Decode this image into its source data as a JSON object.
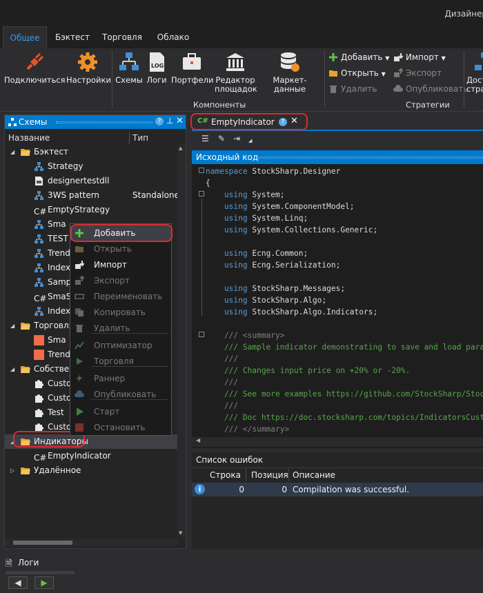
{
  "window": {
    "title": "Дизайнер"
  },
  "ribbon_tabs": [
    "Общее",
    "Бэктест",
    "Торговля",
    "Облако"
  ],
  "ribbon": {
    "connect": "Подключиться",
    "settings": "Настройки",
    "schemes": "Схемы",
    "logs": "Логи",
    "portfolios": "Портфели",
    "board_editor": "Редактор площадок",
    "market_data": "Маркет-данные",
    "components_group": "Компоненты",
    "add": "Добавить",
    "import": "Импорт",
    "open": "Открыть",
    "export": "Экспорт",
    "delete": "Удалить",
    "publish": "Опубликовать",
    "strategies_group": "Стратегии",
    "available": "Дост",
    "available2": "стра"
  },
  "schemes_panel": {
    "title": "Схемы",
    "col_name": "Название",
    "col_type": "Тип",
    "rows": [
      {
        "label": "Бэктест",
        "type": ""
      },
      {
        "label": "Strategy",
        "type": ""
      },
      {
        "label": "designertestdll",
        "type": ""
      },
      {
        "label": "3WS pattern",
        "type": "Standalone"
      },
      {
        "label": "EmptyStrategy",
        "type": ""
      },
      {
        "label": "Sma",
        "type": ""
      },
      {
        "label": "TEST",
        "type": ""
      },
      {
        "label": "Trend",
        "type": ""
      },
      {
        "label": "Index",
        "type": ""
      },
      {
        "label": "Sampl",
        "type": ""
      },
      {
        "label": "SmaSt",
        "type": ""
      },
      {
        "label": "Index",
        "type": ""
      },
      {
        "label": "Торговля",
        "type": ""
      },
      {
        "label": "Sma",
        "type": ""
      },
      {
        "label": "Trend",
        "type": ""
      },
      {
        "label": "Собствен",
        "type": ""
      },
      {
        "label": "Custor",
        "type": ""
      },
      {
        "label": "Custor",
        "type": ""
      },
      {
        "label": "Test",
        "type": ""
      },
      {
        "label": "Custor",
        "type": ""
      },
      {
        "label": "Индикаторы",
        "type": ""
      },
      {
        "label": "EmptyIndicator",
        "type": ""
      },
      {
        "label": "Удалённое",
        "type": ""
      }
    ]
  },
  "context_menu": {
    "items": [
      "Добавить",
      "Открыть",
      "Импорт",
      "Экспорт",
      "Переименовать",
      "Копировать",
      "Удалить",
      "Оптимизатор",
      "Торговля",
      "Раннер",
      "Опубликовать",
      "Старт",
      "Остановить"
    ]
  },
  "doc_tab": {
    "label": "EmptyIndicator"
  },
  "editor": {
    "title": "Исходный код",
    "lines": [
      {
        "k": "namespace",
        "t": " StockSharp.Designer"
      },
      {
        "k": "",
        "t": "{"
      },
      {
        "k": "    using",
        "t": " System;"
      },
      {
        "k": "    using",
        "t": " System.ComponentModel;"
      },
      {
        "k": "    using",
        "t": " System.Linq;"
      },
      {
        "k": "    using",
        "t": " System.Collections.Generic;"
      },
      {
        "k": "",
        "t": ""
      },
      {
        "k": "    using",
        "t": " Ecng.Common;"
      },
      {
        "k": "    using",
        "t": " Ecng.Serialization;"
      },
      {
        "k": "",
        "t": ""
      },
      {
        "k": "    using",
        "t": " StockSharp.Messages;"
      },
      {
        "k": "    using",
        "t": " StockSharp.Algo;"
      },
      {
        "k": "    using",
        "t": " StockSharp.Algo.Indicators;"
      },
      {
        "k": "",
        "t": ""
      },
      {
        "c": "    /// <summary>",
        "g": true
      },
      {
        "c": "    /// Sample indicator demonstrating to save and load param"
      },
      {
        "c": "    ///",
        "g": true
      },
      {
        "c": "    /// Changes input price on +20% or -20%."
      },
      {
        "c": "    ///",
        "g": true
      },
      {
        "c": "    /// See more examples https://github.com/StockSharp/Stock"
      },
      {
        "c": "    ///",
        "g": true
      },
      {
        "c": "    /// Doc https://doc.stocksharp.com/topics/IndicatorsCusto"
      },
      {
        "c": "    /// </summary>",
        "g": true
      }
    ]
  },
  "errors": {
    "title": "Список ошибок",
    "col_line": "Строка",
    "col_pos": "Позиция",
    "col_desc": "Описание",
    "rows": [
      {
        "line": "0",
        "pos": "0",
        "desc": "Compilation was successful."
      }
    ]
  },
  "bottom": {
    "logs": "Логи"
  }
}
